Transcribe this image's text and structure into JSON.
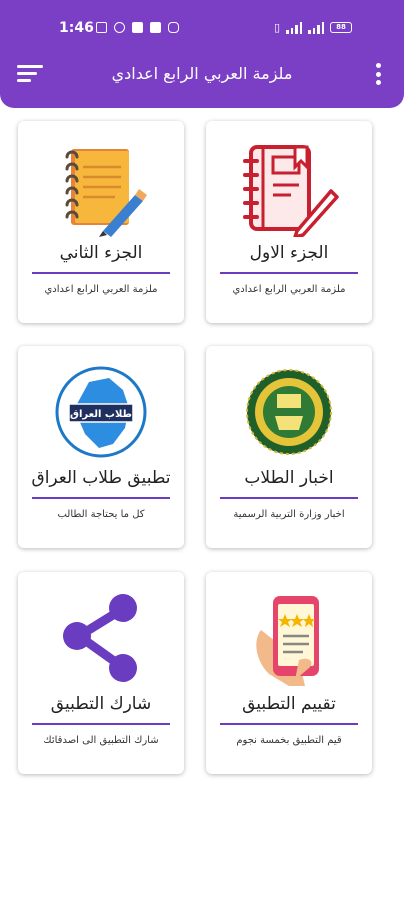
{
  "status_bar": {
    "time": "1:46",
    "battery": "88"
  },
  "app_bar": {
    "title": "ملزمة العربي الرابع اعدادي"
  },
  "cards": [
    {
      "title": "الجزء الاول",
      "subtitle": "ملزمة العربي الرابع اعدادي",
      "icon": "notebook-pencil-icon"
    },
    {
      "title": "الجزء الثاني",
      "subtitle": "ملزمة العربي الرابع اعدادي",
      "icon": "notepad-pencil-icon"
    },
    {
      "title": "اخبار الطلاب",
      "subtitle": "اخبار وزارة التربية الرسمية",
      "icon": "ministry-seal-icon"
    },
    {
      "title": "تطبيق طلاب العراق",
      "subtitle": "كل ما يحتاجة الطالب",
      "icon": "iraq-map-logo-icon",
      "logo_text": "طلاب العراق"
    },
    {
      "title": "تقييم التطبيق",
      "subtitle": "قيم التطبيق بخمسة نجوم",
      "icon": "phone-rating-icon"
    },
    {
      "title": "شارك التطبيق",
      "subtitle": "شارك التطبيق الى اصدقائك",
      "icon": "share-icon"
    }
  ],
  "colors": {
    "primary": "#7b3fc6",
    "divider": "#6a3cbf"
  }
}
